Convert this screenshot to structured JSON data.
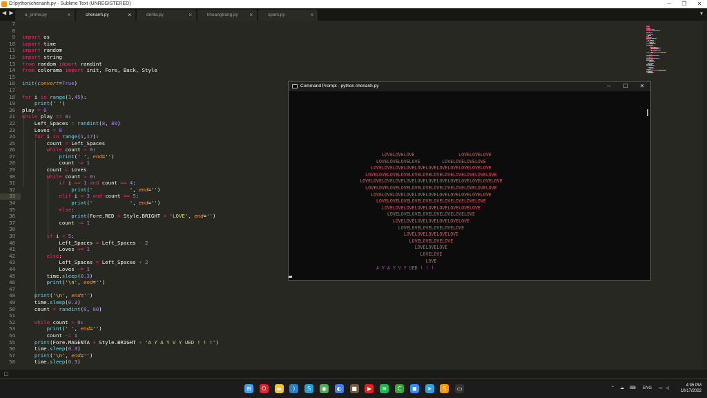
{
  "window": {
    "title": "D:\\python\\chenanh.py - Sublime Text (UNREGISTERED)"
  },
  "tabs": [
    {
      "label": "a_prime.py",
      "active": false
    },
    {
      "label": "chenanh.py",
      "active": true
    },
    {
      "label": "derita.py",
      "active": false
    },
    {
      "label": "khoangtrang.py",
      "active": false
    },
    {
      "label": "spam.py",
      "active": false
    }
  ],
  "editor": {
    "line_numbers": [
      "7",
      "8",
      "9",
      "10",
      "11",
      "12",
      "13",
      "14",
      "15",
      "16",
      "17",
      "18",
      "19",
      "20",
      "21",
      "22",
      "23",
      "24",
      "25",
      "26",
      "27",
      "28",
      "29",
      "30",
      "31",
      "32",
      "33",
      "34",
      "35",
      "36",
      "37",
      "38",
      "39",
      "40",
      "41",
      "42",
      "43",
      "44",
      "45",
      "46",
      "47",
      "48",
      "49",
      "50",
      "51",
      "52",
      "53",
      "54",
      "55",
      "56",
      "57",
      "58"
    ],
    "code_lines": [
      [],
      [],
      [
        {
          "t": "import",
          "c": "kw"
        },
        {
          "t": " os"
        }
      ],
      [
        {
          "t": "import",
          "c": "kw"
        },
        {
          "t": " time"
        }
      ],
      [
        {
          "t": "import",
          "c": "kw"
        },
        {
          "t": " random"
        }
      ],
      [
        {
          "t": "import",
          "c": "kw"
        },
        {
          "t": " string"
        }
      ],
      [
        {
          "t": "from",
          "c": "kw"
        },
        {
          "t": " random "
        },
        {
          "t": "import",
          "c": "kw"
        },
        {
          "t": " randint"
        }
      ],
      [
        {
          "t": "from",
          "c": "kw"
        },
        {
          "t": " colorama "
        },
        {
          "t": "import",
          "c": "kw"
        },
        {
          "t": " init, Fore, Back, Style"
        }
      ],
      [],
      [
        {
          "t": "init(",
          "c": "fn"
        },
        {
          "t": "convert",
          "c": "ar"
        },
        {
          "t": "="
        },
        {
          "t": "True",
          "c": "nm"
        },
        {
          "t": ")"
        }
      ],
      [],
      [
        {
          "t": "for",
          "c": "kw"
        },
        {
          "t": " i "
        },
        {
          "t": "in",
          "c": "kw"
        },
        {
          "t": " "
        },
        {
          "t": "range",
          "c": "fn"
        },
        {
          "t": "("
        },
        {
          "t": "1",
          "c": "nm"
        },
        {
          "t": ","
        },
        {
          "t": "45",
          "c": "nm"
        },
        {
          "t": "):"
        }
      ],
      [
        {
          "t": "    "
        },
        {
          "t": "print",
          "c": "fn"
        },
        {
          "t": "("
        },
        {
          "t": "' '",
          "c": "st"
        },
        {
          "t": ")"
        }
      ],
      [
        {
          "t": "play "
        },
        {
          "t": "=",
          "c": "kw"
        },
        {
          "t": " "
        },
        {
          "t": "0",
          "c": "nm"
        }
      ],
      [
        {
          "t": "while",
          "c": "kw"
        },
        {
          "t": " play "
        },
        {
          "t": "==",
          "c": "kw"
        },
        {
          "t": " "
        },
        {
          "t": "0",
          "c": "nm"
        },
        {
          "t": ":"
        }
      ],
      [
        {
          "t": "    Left_Spaces "
        },
        {
          "t": "=",
          "c": "kw"
        },
        {
          "t": " "
        },
        {
          "t": "randint",
          "c": "fn"
        },
        {
          "t": "("
        },
        {
          "t": "8",
          "c": "nm"
        },
        {
          "t": ", "
        },
        {
          "t": "80",
          "c": "nm"
        },
        {
          "t": ")"
        }
      ],
      [
        {
          "t": "    Loves "
        },
        {
          "t": "=",
          "c": "kw"
        },
        {
          "t": " "
        },
        {
          "t": "8",
          "c": "nm"
        }
      ],
      [
        {
          "t": "    "
        },
        {
          "t": "for",
          "c": "kw"
        },
        {
          "t": " i "
        },
        {
          "t": "in",
          "c": "kw"
        },
        {
          "t": " "
        },
        {
          "t": "range",
          "c": "fn"
        },
        {
          "t": "("
        },
        {
          "t": "1",
          "c": "nm"
        },
        {
          "t": ","
        },
        {
          "t": "17",
          "c": "nm"
        },
        {
          "t": "):"
        }
      ],
      [
        {
          "t": "        count "
        },
        {
          "t": "=",
          "c": "kw"
        },
        {
          "t": " Left_Spaces"
        }
      ],
      [
        {
          "t": "        "
        },
        {
          "t": "while",
          "c": "kw"
        },
        {
          "t": " count "
        },
        {
          "t": ">",
          "c": "kw"
        },
        {
          "t": " "
        },
        {
          "t": "0",
          "c": "nm"
        },
        {
          "t": ":"
        }
      ],
      [
        {
          "t": "            "
        },
        {
          "t": "print",
          "c": "fn"
        },
        {
          "t": "("
        },
        {
          "t": "' '",
          "c": "st"
        },
        {
          "t": ", "
        },
        {
          "t": "end",
          "c": "ar"
        },
        {
          "t": "="
        },
        {
          "t": "''",
          "c": "st"
        },
        {
          "t": ")"
        }
      ],
      [
        {
          "t": "            count "
        },
        {
          "t": "-=",
          "c": "kw"
        },
        {
          "t": " "
        },
        {
          "t": "1",
          "c": "nm"
        }
      ],
      [
        {
          "t": "        count "
        },
        {
          "t": "=",
          "c": "kw"
        },
        {
          "t": " Loves"
        }
      ],
      [
        {
          "t": "        "
        },
        {
          "t": "while",
          "c": "kw"
        },
        {
          "t": " count "
        },
        {
          "t": ">",
          "c": "kw"
        },
        {
          "t": " "
        },
        {
          "t": "0",
          "c": "nm"
        },
        {
          "t": ":"
        }
      ],
      [
        {
          "t": "            "
        },
        {
          "t": "if",
          "c": "kw"
        },
        {
          "t": " i "
        },
        {
          "t": "==",
          "c": "kw"
        },
        {
          "t": " "
        },
        {
          "t": "1",
          "c": "nm"
        },
        {
          "t": " "
        },
        {
          "t": "and",
          "c": "kw"
        },
        {
          "t": " count "
        },
        {
          "t": "==",
          "c": "kw"
        },
        {
          "t": " "
        },
        {
          "t": "4",
          "c": "nm"
        },
        {
          "t": ":"
        }
      ],
      [
        {
          "t": "                "
        },
        {
          "t": "print",
          "c": "fn"
        },
        {
          "t": "("
        },
        {
          "t": "'            '",
          "c": "st"
        },
        {
          "t": ", "
        },
        {
          "t": "end",
          "c": "ar"
        },
        {
          "t": "="
        },
        {
          "t": "''",
          "c": "st"
        },
        {
          "t": ")"
        }
      ],
      [
        {
          "t": "            "
        },
        {
          "t": "elif",
          "c": "kw"
        },
        {
          "t": " i "
        },
        {
          "t": "<",
          "c": "kw"
        },
        {
          "t": " "
        },
        {
          "t": "3",
          "c": "nm"
        },
        {
          "t": " "
        },
        {
          "t": "and",
          "c": "kw"
        },
        {
          "t": " count "
        },
        {
          "t": "==",
          "c": "kw"
        },
        {
          "t": " "
        },
        {
          "t": "5",
          "c": "nm"
        },
        {
          "t": ":"
        }
      ],
      [
        {
          "t": "                "
        },
        {
          "t": "print",
          "c": "fn"
        },
        {
          "t": "("
        },
        {
          "t": "'            '",
          "c": "st"
        },
        {
          "t": ", "
        },
        {
          "t": "end",
          "c": "ar"
        },
        {
          "t": "="
        },
        {
          "t": "''",
          "c": "st"
        },
        {
          "t": ")"
        }
      ],
      [
        {
          "t": "            "
        },
        {
          "t": "else",
          "c": "kw"
        },
        {
          "t": ":"
        }
      ],
      [
        {
          "t": "                "
        },
        {
          "t": "print",
          "c": "fn"
        },
        {
          "t": "(Fore.RED "
        },
        {
          "t": "+",
          "c": "kw"
        },
        {
          "t": " Style.BRIGHT "
        },
        {
          "t": "+",
          "c": "kw"
        },
        {
          "t": " "
        },
        {
          "t": "'LOVE'",
          "c": "st"
        },
        {
          "t": ", "
        },
        {
          "t": "end",
          "c": "ar"
        },
        {
          "t": "="
        },
        {
          "t": "''",
          "c": "st"
        },
        {
          "t": ")"
        }
      ],
      [
        {
          "t": "            count "
        },
        {
          "t": "-=",
          "c": "kw"
        },
        {
          "t": " "
        },
        {
          "t": "1",
          "c": "nm"
        }
      ],
      [],
      [
        {
          "t": "        "
        },
        {
          "t": "if",
          "c": "kw"
        },
        {
          "t": " i "
        },
        {
          "t": "<",
          "c": "kw"
        },
        {
          "t": " "
        },
        {
          "t": "5",
          "c": "nm"
        },
        {
          "t": ":"
        }
      ],
      [
        {
          "t": "            Left_Spaces "
        },
        {
          "t": "=",
          "c": "kw"
        },
        {
          "t": " Left_Spaces "
        },
        {
          "t": "-",
          "c": "kw"
        },
        {
          "t": " "
        },
        {
          "t": "2",
          "c": "nm"
        }
      ],
      [
        {
          "t": "            Loves "
        },
        {
          "t": "+=",
          "c": "kw"
        },
        {
          "t": " "
        },
        {
          "t": "1",
          "c": "nm"
        }
      ],
      [
        {
          "t": "        "
        },
        {
          "t": "else",
          "c": "kw"
        },
        {
          "t": ":"
        }
      ],
      [
        {
          "t": "            Left_Spaces "
        },
        {
          "t": "=",
          "c": "kw"
        },
        {
          "t": " Left_Spaces "
        },
        {
          "t": "+",
          "c": "kw"
        },
        {
          "t": " "
        },
        {
          "t": "2",
          "c": "nm"
        }
      ],
      [
        {
          "t": "            Loves "
        },
        {
          "t": "-=",
          "c": "kw"
        },
        {
          "t": " "
        },
        {
          "t": "1",
          "c": "nm"
        }
      ],
      [
        {
          "t": "        time."
        },
        {
          "t": "sleep",
          "c": "fn"
        },
        {
          "t": "("
        },
        {
          "t": "0.3",
          "c": "nm"
        },
        {
          "t": ")"
        }
      ],
      [
        {
          "t": "        "
        },
        {
          "t": "print",
          "c": "fn"
        },
        {
          "t": "("
        },
        {
          "t": "'\\n'",
          "c": "st"
        },
        {
          "t": ", "
        },
        {
          "t": "end",
          "c": "ar"
        },
        {
          "t": "="
        },
        {
          "t": "''",
          "c": "st"
        },
        {
          "t": ")"
        }
      ],
      [],
      [
        {
          "t": "    "
        },
        {
          "t": "print",
          "c": "fn"
        },
        {
          "t": "("
        },
        {
          "t": "'\\n'",
          "c": "st"
        },
        {
          "t": ", "
        },
        {
          "t": "end",
          "c": "ar"
        },
        {
          "t": "="
        },
        {
          "t": "''",
          "c": "st"
        },
        {
          "t": ")"
        }
      ],
      [
        {
          "t": "    time."
        },
        {
          "t": "sleep",
          "c": "fn"
        },
        {
          "t": "("
        },
        {
          "t": "0.3",
          "c": "nm"
        },
        {
          "t": ")"
        }
      ],
      [
        {
          "t": "    count "
        },
        {
          "t": "=",
          "c": "kw"
        },
        {
          "t": " "
        },
        {
          "t": "randint",
          "c": "fn"
        },
        {
          "t": "("
        },
        {
          "t": "8",
          "c": "nm"
        },
        {
          "t": ", "
        },
        {
          "t": "80",
          "c": "nm"
        },
        {
          "t": ")"
        }
      ],
      [],
      [
        {
          "t": "    "
        },
        {
          "t": "while",
          "c": "kw"
        },
        {
          "t": " count "
        },
        {
          "t": ">",
          "c": "kw"
        },
        {
          "t": " "
        },
        {
          "t": "0",
          "c": "nm"
        },
        {
          "t": ":"
        }
      ],
      [
        {
          "t": "        "
        },
        {
          "t": "print",
          "c": "fn"
        },
        {
          "t": "("
        },
        {
          "t": "' '",
          "c": "st"
        },
        {
          "t": ", "
        },
        {
          "t": "end",
          "c": "ar"
        },
        {
          "t": "="
        },
        {
          "t": "''",
          "c": "st"
        },
        {
          "t": ")"
        }
      ],
      [
        {
          "t": "        count "
        },
        {
          "t": "-=",
          "c": "kw"
        },
        {
          "t": " "
        },
        {
          "t": "1",
          "c": "nm"
        }
      ],
      [
        {
          "t": "    "
        },
        {
          "t": "print",
          "c": "fn"
        },
        {
          "t": "(Fore.MAGENTA "
        },
        {
          "t": "+",
          "c": "kw"
        },
        {
          "t": " Style.BRIGHT "
        },
        {
          "t": "+",
          "c": "kw"
        },
        {
          "t": " "
        },
        {
          "t": "'A Y A Y V Y UED ! ! !'",
          "c": "st"
        },
        {
          "t": ")"
        }
      ],
      [
        {
          "t": "    time."
        },
        {
          "t": "sleep",
          "c": "fn"
        },
        {
          "t": "("
        },
        {
          "t": "0.3",
          "c": "nm"
        },
        {
          "t": ")"
        }
      ],
      [
        {
          "t": "    "
        },
        {
          "t": "print",
          "c": "fn"
        },
        {
          "t": "("
        },
        {
          "t": "'\\n'",
          "c": "st"
        },
        {
          "t": ", "
        },
        {
          "t": "end",
          "c": "ar"
        },
        {
          "t": "="
        },
        {
          "t": "''",
          "c": "st"
        },
        {
          "t": ")"
        }
      ],
      [
        {
          "t": "    time."
        },
        {
          "t": "sleep",
          "c": "fn"
        },
        {
          "t": "("
        },
        {
          "t": "0.3",
          "c": "nm"
        },
        {
          "t": ")"
        }
      ]
    ]
  },
  "cmd": {
    "title": "Command Prompt - python  chenanh.py",
    "heart_lines": [
      "                                  LOVELOVELOVE                LOVELOVELOVE",
      "                                LOVELOVELOVELOVE        LOVELOVELOVELOVE",
      "                              LOVELOVELOVELOVELOVELOVELOVELOVELOVELOVELOVE",
      "                            LOVELOVELOVELOVELOVELOVELOVELOVELOVELOVELOVELOVE",
      "                          LOVELOVELOVELOVELOVELOVELOVELOVELOVELOVELOVELOVELOVE",
      "                            LOVELOVELOVELOVELOVELOVELOVELOVELOVELOVELOVELOVE",
      "                              LOVELOVELOVELOVELOVELOVELOVELOVELOVELOVELOVE",
      "                                LOVELOVELOVELOVELOVELOVELOVELOVELOVELOVE",
      "                                  LOVELOVELOVELOVELOVELOVELOVELOVELOVE",
      "                                    LOVELOVELOVELOVELOVELOVELOVELOVE",
      "                                      LOVELOVELOVELOVELOVELOVELOVE",
      "                                        LOVELOVELOVELOVELOVELOVE",
      "                                          LOVELOVELOVELOVELOVE",
      "                                            LOVELOVELOVELOVE",
      "                                              LOVELOVELOVE",
      "                                                LOVELOVE",
      "                                                  LOVE"
    ],
    "message": "A Y A Y V Y UED ! ! !",
    "heart_color": "#e05a5a",
    "message_color": "#c045c6"
  },
  "taskbar": {
    "icons": [
      {
        "name": "windows-start-icon",
        "glyph": "⊞",
        "color": "#3aa0f3"
      },
      {
        "name": "opera-icon",
        "glyph": "O",
        "color": "#e0242e"
      },
      {
        "name": "file-explorer-icon",
        "glyph": "▬",
        "color": "#f3c13a"
      },
      {
        "name": "vscode-icon",
        "glyph": "⟩",
        "color": "#2a7fd1"
      },
      {
        "name": "skype-icon",
        "glyph": "S",
        "color": "#1e9fe0"
      },
      {
        "name": "chrome-icon",
        "glyph": "◉",
        "color": "#4caf50"
      },
      {
        "name": "messenger-icon",
        "glyph": "◐",
        "color": "#3b82f6"
      },
      {
        "name": "minecraft-icon",
        "glyph": "■",
        "color": "#7a5c3a"
      },
      {
        "name": "youtube-icon",
        "glyph": "▶",
        "color": "#e62117"
      },
      {
        "name": "spotify-icon",
        "glyph": "≋",
        "color": "#1db954"
      },
      {
        "name": "camtasia-icon",
        "glyph": "C",
        "color": "#37a53c"
      },
      {
        "name": "zoom-icon",
        "glyph": "◼",
        "color": "#2d8cff"
      },
      {
        "name": "telegram-icon",
        "glyph": "➤",
        "color": "#2aa3df"
      },
      {
        "name": "sublime-text-icon",
        "glyph": "S",
        "color": "#ff9800"
      },
      {
        "name": "command-prompt-icon",
        "glyph": "▭",
        "color": "#333333"
      }
    ],
    "tray": {
      "language": "ENG",
      "time": "4:35 PM",
      "date": "10/17/2022"
    }
  }
}
